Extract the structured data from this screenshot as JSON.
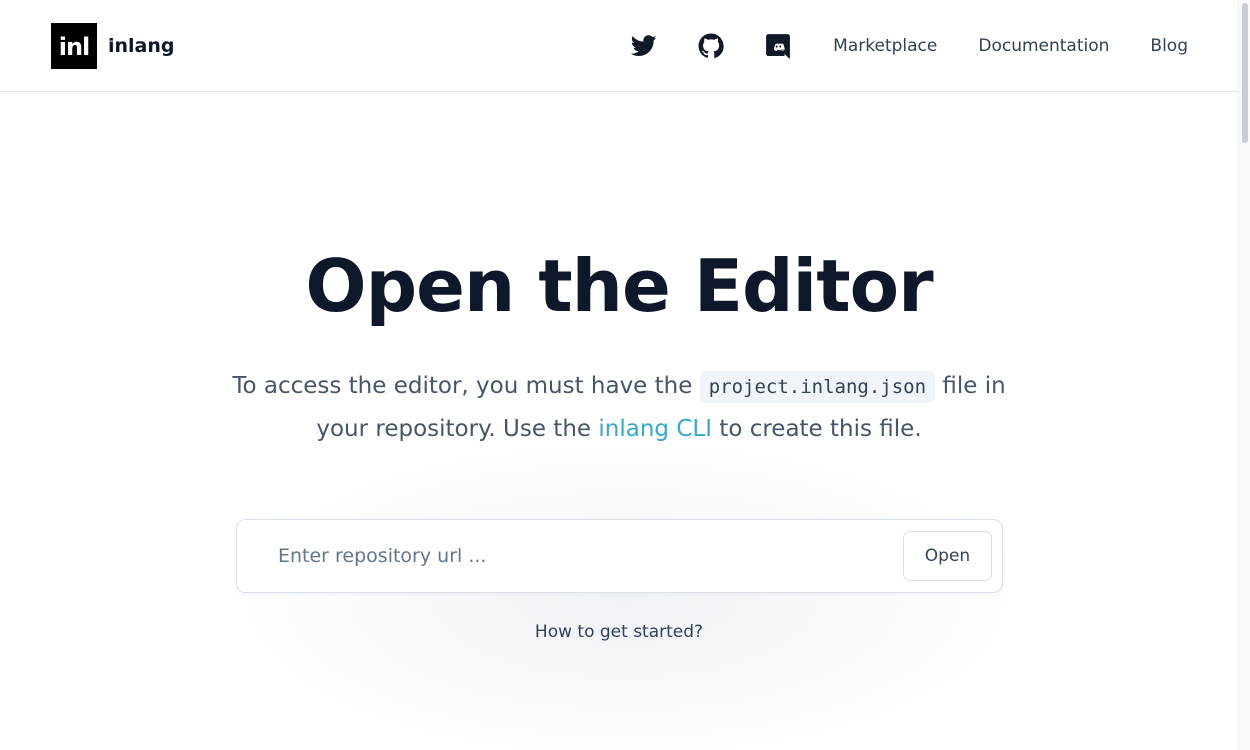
{
  "brand": {
    "logo_mark": "inl",
    "name": "inlang"
  },
  "nav": {
    "icons": [
      "twitter-icon",
      "github-icon",
      "discord-icon"
    ],
    "links": [
      "Marketplace",
      "Documentation",
      "Blog"
    ]
  },
  "hero": {
    "title": "Open the Editor",
    "subtitle_part1": "To access the editor, you must have the",
    "code": "project.inlang.json",
    "subtitle_part2": "file in your repository. Use the",
    "cli_link": "inlang CLI",
    "subtitle_part3": "to create this file."
  },
  "search": {
    "placeholder": "Enter repository url ...",
    "value": "",
    "button_label": "Open"
  },
  "help": {
    "label": "How to get started?"
  },
  "colors": {
    "accent": "#38a9c9",
    "title": "#0f172a",
    "text": "#475569"
  }
}
